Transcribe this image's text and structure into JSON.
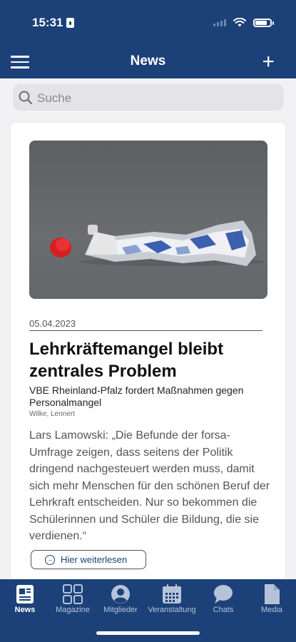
{
  "status": {
    "time": "15:31"
  },
  "header": {
    "title": "News"
  },
  "search": {
    "placeholder": "Suche"
  },
  "article": {
    "date": "05.04.2023",
    "headline": "Lehrkräftemangel bleibt zentrales Problem",
    "subheadline": "VBE Rheinland-Pfalz fordert Maßnahmen gegen Personalmangel",
    "author": "Wilke, Lennert",
    "body": "Lars Lamowski: „Die Befunde der forsa-Umfrage zeigen, dass seitens der Politik dringend nachgesteuert werden muss, damit sich mehr Menschen für den schönen Beruf der Lehrkraft entscheiden. Nur so bekommen die Schülerinnen und Schüler die Bildung, die sie verdienen.“",
    "read_more": "Hier weiterlesen"
  },
  "tabs": [
    {
      "label": "News",
      "icon": "newspaper-icon",
      "active": true
    },
    {
      "label": "Magazine",
      "icon": "grid-icon",
      "active": false
    },
    {
      "label": "Mitglieder",
      "icon": "person-icon",
      "active": false
    },
    {
      "label": "Veranstaltung",
      "icon": "calendar-icon",
      "active": false
    },
    {
      "label": "Chats",
      "icon": "chat-bubble-icon",
      "active": false
    },
    {
      "label": "Media",
      "icon": "document-icon",
      "active": false
    }
  ],
  "colors": {
    "brand": "#1c4179",
    "background": "#f2f2f4",
    "tab_inactive": "#b5c3d9"
  }
}
